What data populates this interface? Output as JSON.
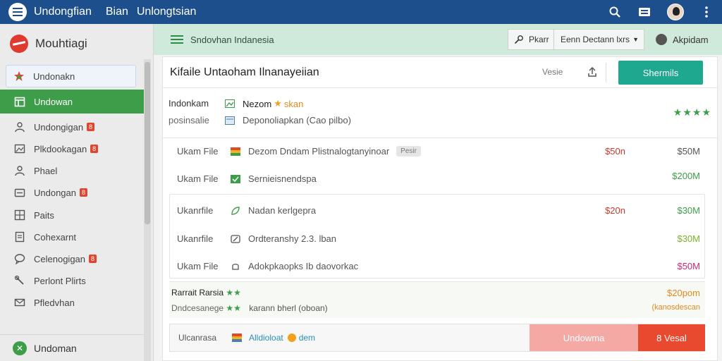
{
  "topbar": {
    "app_title": "Undongfian",
    "nav_link_1": "Bian",
    "nav_link_2": "Unlongtsian",
    "colors": {
      "bar": "#1d4f8c"
    },
    "icons": [
      "search-icon",
      "inbox-icon",
      "user-avatar",
      "more-vertical-icon"
    ]
  },
  "sidebar": {
    "brand": "Mouhtiagi",
    "items": [
      {
        "label": "Undonakn",
        "icon": "star-icon",
        "badge": ""
      },
      {
        "label": "Undowan",
        "icon": "calendar-icon",
        "badge": ""
      },
      {
        "label": "Undongigan",
        "icon": "person-icon",
        "badge": "8"
      },
      {
        "label": "Plkdookagan",
        "icon": "image-icon",
        "badge": "8"
      },
      {
        "label": "Phael",
        "icon": "person-icon",
        "badge": ""
      },
      {
        "label": "Undongan",
        "icon": "folder-icon",
        "badge": "8"
      },
      {
        "label": "Paits",
        "icon": "grid-icon",
        "badge": ""
      },
      {
        "label": "Cohexarnt",
        "icon": "document-icon",
        "badge": ""
      },
      {
        "label": "Celenogigan",
        "icon": "chat-icon",
        "badge": "8"
      },
      {
        "label": "Perlont Plirts",
        "icon": "wrench-icon",
        "badge": ""
      },
      {
        "label": "Pfledvhan",
        "icon": "mail-icon",
        "badge": ""
      }
    ],
    "footer": "Undoman",
    "colors": {
      "active": "#3e9d49"
    }
  },
  "subbar": {
    "title": "Sndovhan Indanesia",
    "search_label": "Pkarr",
    "select_value": "Eenn Dectann lxrs",
    "user_name": "Akpidam"
  },
  "card": {
    "title": "Kifaile Untaoham Ilnanayeiian",
    "view_label": "Vesie",
    "primary_button": "Shermils",
    "summary": {
      "label_1": "Indonkam",
      "desc_1": "Nezom",
      "desc_1_accent": "skan",
      "label_2": "posinsalie",
      "desc_2": "Deponoliapkan (Cao pilbo)",
      "stars": "★★★★"
    },
    "rows": [
      {
        "label": "Ukam File",
        "desc": "Dezom Dndam Plistnalogtanyinoar",
        "tag": "Pesir",
        "amount_1": "$50n",
        "amount_2": "$50M",
        "icon_color": "#e04a2a"
      },
      {
        "label": "Ukam File",
        "desc": "Sernieisnendspa",
        "tag": "",
        "amount_1": "",
        "amount_2": "$200M",
        "icon_color": "#3e9d49"
      },
      {
        "label": "Ukanrfile",
        "desc": "Nadan kerlgepra",
        "tag": "",
        "amount_1": "$20n",
        "amount_2": "$30M",
        "icon_color": "#3e9d49"
      },
      {
        "label": "Ukanrfile",
        "desc": "Ordteranshy 2.3. lban",
        "tag": "",
        "amount_1": "",
        "amount_2": "$30M",
        "icon_color": "#555555"
      },
      {
        "label": "Ukam File",
        "desc": "Adokpkaopks Ib daovorkac",
        "tag": "",
        "amount_1": "",
        "amount_2": "$50M",
        "icon_color": "#555555"
      }
    ],
    "highlight": {
      "label_1": "Rarrait Rarsia",
      "label_2": "Dndcesanege",
      "desc": "karann bherl (oboan)",
      "amount": "$20pom",
      "amount_sub": "(kanosdescan"
    },
    "footer": {
      "label": "Ulcanrasa",
      "desc": "Alldioloat",
      "desc_accent": "dem",
      "pink_button": "Undowma",
      "red_button": "8 Vesal"
    }
  }
}
